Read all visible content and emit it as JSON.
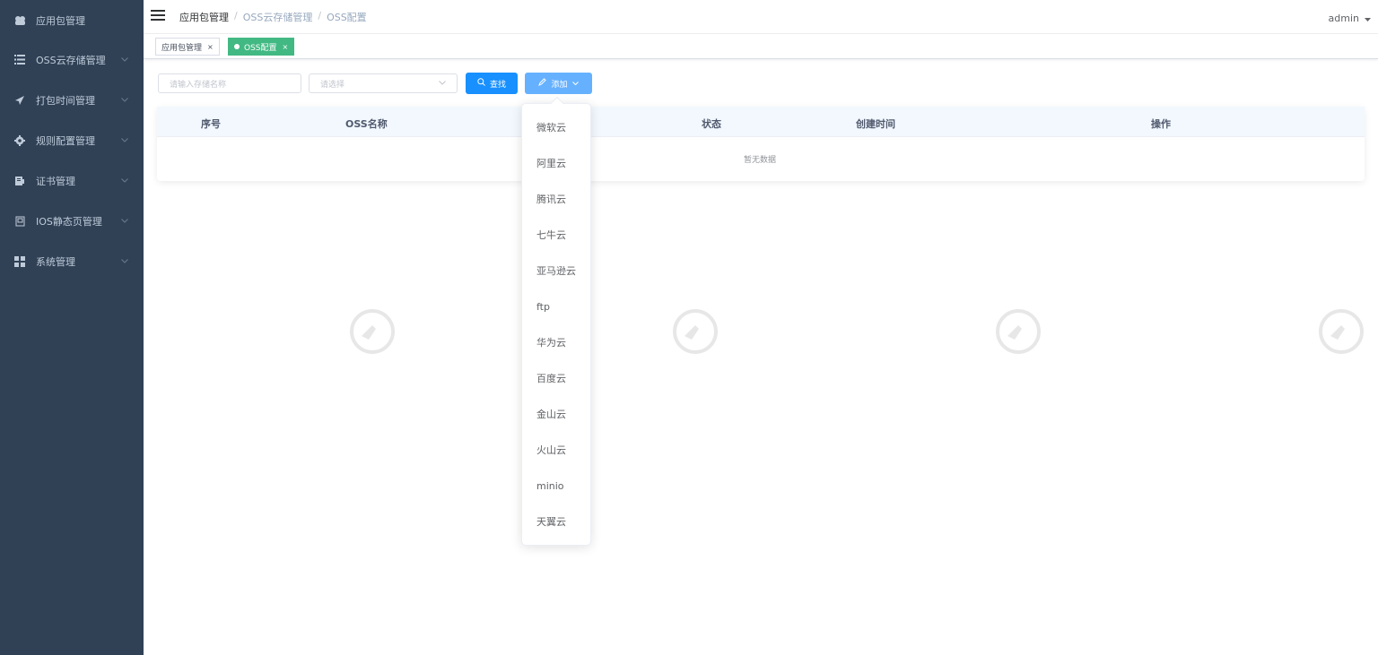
{
  "sidebar": {
    "items": [
      {
        "label": "应用包管理",
        "icon": "app-package-icon",
        "expandable": false
      },
      {
        "label": "OSS云存储管理",
        "icon": "list-icon",
        "expandable": true
      },
      {
        "label": "打包时间管理",
        "icon": "send-icon",
        "expandable": true
      },
      {
        "label": "规则配置管理",
        "icon": "gear-icon",
        "expandable": true
      },
      {
        "label": "证书管理",
        "icon": "certificate-icon",
        "expandable": true
      },
      {
        "label": "IOS静态页管理",
        "icon": "page-icon",
        "expandable": true
      },
      {
        "label": "系统管理",
        "icon": "grid-icon",
        "expandable": true
      }
    ]
  },
  "navbar": {
    "breadcrumb": [
      "应用包管理",
      "OSS云存储管理",
      "OSS配置"
    ],
    "user": "admin"
  },
  "tags": [
    {
      "label": "应用包管理",
      "active": false
    },
    {
      "label": "OSS配置",
      "active": true
    }
  ],
  "toolbar": {
    "name_placeholder": "请输入存储名称",
    "select_placeholder": "请选择",
    "search_label": "查找",
    "add_label": "添加"
  },
  "table": {
    "columns": [
      "序号",
      "OSS名称",
      "状态",
      "创建时间",
      "操作"
    ],
    "empty_text": "暂无数据"
  },
  "add_menu": {
    "items": [
      "微软云",
      "阿里云",
      "腾讯云",
      "七牛云",
      "亚马逊云",
      "ftp",
      "华为云",
      "百度云",
      "金山云",
      "火山云",
      "minio",
      "天翼云"
    ]
  },
  "colors": {
    "sidebar_bg": "#304156",
    "primary": "#1890ff",
    "active_tag": "#42b983"
  }
}
